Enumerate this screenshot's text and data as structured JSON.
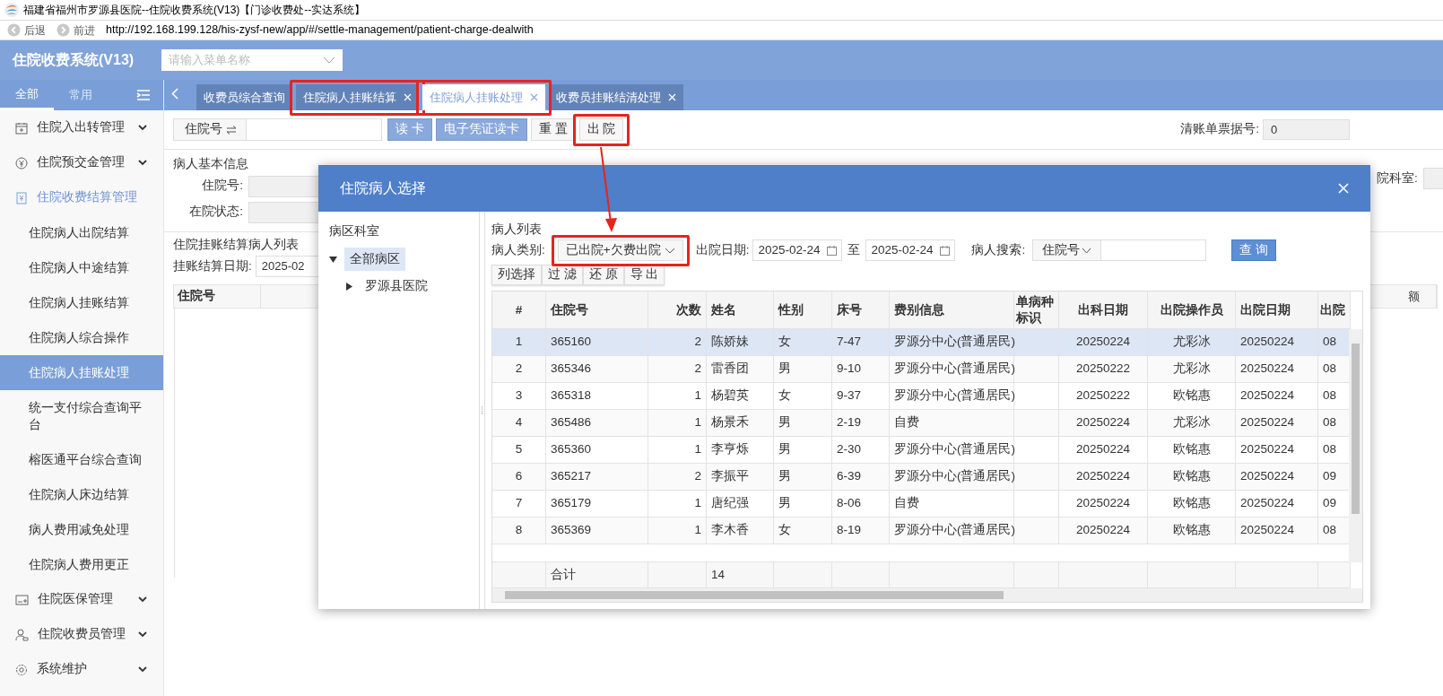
{
  "window": {
    "title": "福建省福州市罗源县医院--住院收费系统(V13)【门诊收费处--实达系统】"
  },
  "browser": {
    "back": "后退",
    "forward": "前进",
    "url": "http://192.168.199.128/his-zysf-new/app/#/settle-management/patient-charge-dealwith"
  },
  "app": {
    "title": "住院收费系统(V13)",
    "menu_search": {
      "placeholder": "请输入菜单名称"
    }
  },
  "sidebar": {
    "tabs": [
      {
        "label": "全部",
        "selected": true
      },
      {
        "label": "常用",
        "selected": false
      }
    ],
    "items": [
      {
        "label": "住院入出转管理",
        "expanded": false
      },
      {
        "label": "住院预交金管理",
        "expanded": false
      },
      {
        "label": "住院收费结算管理",
        "expanded": true,
        "children": [
          {
            "label": "住院病人出院结算",
            "selected": false
          },
          {
            "label": "住院病人中途结算",
            "selected": false
          },
          {
            "label": "住院病人挂账结算",
            "selected": false
          },
          {
            "label": "住院病人综合操作",
            "selected": false
          },
          {
            "label": "住院病人挂账处理",
            "selected": true
          },
          {
            "label": "统一支付综合查询平台",
            "selected": false
          },
          {
            "label": "榕医通平台综合查询",
            "selected": false
          },
          {
            "label": "住院病人床边结算",
            "selected": false
          },
          {
            "label": "病人费用减免处理",
            "selected": false
          },
          {
            "label": "住院病人费用更正",
            "selected": false
          }
        ]
      },
      {
        "label": "住院医保管理",
        "expanded": false
      },
      {
        "label": "住院收费员管理",
        "expanded": false
      },
      {
        "label": "系统维护",
        "expanded": false
      }
    ]
  },
  "tabs": [
    {
      "label": "收费员综合查询",
      "selected": false,
      "closable": false
    },
    {
      "label": "住院病人挂账结算",
      "selected": false,
      "closable": true
    },
    {
      "label": "住院病人挂账处理",
      "selected": true,
      "closable": true
    },
    {
      "label": "收费员挂账结清处理",
      "selected": false,
      "closable": true
    }
  ],
  "toolbar": {
    "id_label": "住院号",
    "buttons": [
      {
        "label": "读 卡",
        "kind": "primary"
      },
      {
        "label": "电子凭证读卡",
        "kind": "primary"
      },
      {
        "label": "重 置",
        "kind": "default"
      },
      {
        "label": "出 院",
        "kind": "default"
      }
    ],
    "receipt_label": "清账单票据号:",
    "receipt_value": "0"
  },
  "patient_info": {
    "title": "病人基本信息",
    "fields": [
      "住院号:",
      "在院状态:"
    ],
    "right_label": "院科室:"
  },
  "settle_list": {
    "title": "住院挂账结算病人列表",
    "date_label": "挂账结算日期:",
    "date_value": "2025-02",
    "columns": [
      "住院号"
    ],
    "right_column": "额"
  },
  "modal": {
    "title": "住院病人选择",
    "ward_panel": {
      "title": "病区科室",
      "tree": [
        {
          "label": "全部病区",
          "selected": true,
          "expanded": true,
          "children": [
            {
              "label": "罗源县医院",
              "selected": false,
              "expanded": false
            }
          ]
        }
      ]
    },
    "list_title": "病人列表",
    "filters": {
      "type_label": "病人类别:",
      "type_value": "已出院+欠费出院",
      "date_label": "出院日期:",
      "date_from": "2025-02-24",
      "date_sep": "至",
      "date_to": "2025-02-24",
      "search_label": "病人搜索:",
      "search_field": "住院号",
      "query_button": "查 询"
    },
    "actions": [
      "列选择",
      "过 滤",
      "还 原",
      "导 出"
    ],
    "table": {
      "columns": [
        "#",
        "住院号",
        "次数",
        "姓名",
        "性别",
        "床号",
        "费别信息",
        "单病种标识",
        "出科日期",
        "出院操作员",
        "出院日期",
        "出院"
      ],
      "rows": [
        {
          "no": "1",
          "id": "365160",
          "times": "2",
          "name": "陈娇妹",
          "sex": "女",
          "bed": "7-47",
          "fee": "罗源分中心(普通居民)",
          "dept_out": "20250224",
          "operator": "尤彩冰",
          "discharge": "20250224",
          "column_12": "08",
          "selected": true
        },
        {
          "no": "2",
          "id": "365346",
          "times": "2",
          "name": "雷香团",
          "sex": "男",
          "bed": "9-10",
          "fee": "罗源分中心(普通居民)",
          "dept_out": "20250222",
          "operator": "尤彩冰",
          "discharge": "20250224",
          "column_12": "08",
          "selected": false
        },
        {
          "no": "3",
          "id": "365318",
          "times": "1",
          "name": "杨碧英",
          "sex": "女",
          "bed": "9-37",
          "fee": "罗源分中心(普通居民)",
          "dept_out": "20250222",
          "operator": "欧铭惠",
          "discharge": "20250224",
          "column_12": "08",
          "selected": false
        },
        {
          "no": "4",
          "id": "365486",
          "times": "1",
          "name": "杨景禾",
          "sex": "男",
          "bed": "2-19",
          "fee": "自费",
          "dept_out": "20250224",
          "operator": "尤彩冰",
          "discharge": "20250224",
          "column_12": "08",
          "selected": false
        },
        {
          "no": "5",
          "id": "365360",
          "times": "1",
          "name": "李亨烁",
          "sex": "男",
          "bed": "2-30",
          "fee": "罗源分中心(普通居民)",
          "dept_out": "20250224",
          "operator": "欧铭惠",
          "discharge": "20250224",
          "column_12": "08",
          "selected": false
        },
        {
          "no": "6",
          "id": "365217",
          "times": "2",
          "name": "李振平",
          "sex": "男",
          "bed": "6-39",
          "fee": "罗源分中心(普通居民)",
          "dept_out": "20250224",
          "operator": "欧铭惠",
          "discharge": "20250224",
          "column_12": "09",
          "selected": false
        },
        {
          "no": "7",
          "id": "365179",
          "times": "1",
          "name": "唐纪强",
          "sex": "男",
          "bed": "8-06",
          "fee": "自费",
          "dept_out": "20250224",
          "operator": "欧铭惠",
          "discharge": "20250224",
          "column_12": "09",
          "selected": false
        },
        {
          "no": "8",
          "id": "365369",
          "times": "1",
          "name": "李木香",
          "sex": "女",
          "bed": "8-19",
          "fee": "罗源分中心(普通居民)",
          "dept_out": "20250224",
          "operator": "欧铭惠",
          "discharge": "20250224",
          "column_12": "08",
          "selected": false
        }
      ],
      "footer": {
        "label": "合计",
        "count": "14"
      }
    }
  }
}
